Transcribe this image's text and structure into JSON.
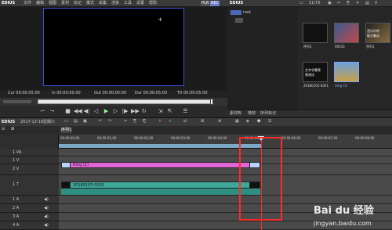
{
  "app": {
    "name": "EDIUS",
    "menus": [
      "文件",
      "编辑",
      "视图",
      "素材",
      "标记",
      "模式",
      "采集",
      "渲染",
      "工具",
      "设置",
      "帮助"
    ],
    "plr": "PLR",
    "rec": "REC"
  },
  "preview": {
    "cur": "Cur 00:00:05:00",
    "in": "In 00:00:00:00",
    "out": "Out 00:00:05:00",
    "dur": "Dur 00:00:05:00",
    "ttl": "Ttl 00:00:05:00",
    "tc_left": "00:00:05:00",
    "tc_right": "00:00:05:00"
  },
  "bin": {
    "app": "EDIUS",
    "path": "11/70",
    "folder_root": "root",
    "items": [
      {
        "label": "序列1"
      },
      {
        "label": "00033"
      },
      {
        "label": "序列1"
      },
      {
        "label": "20180105-0001"
      },
      {
        "label": "timg (1)"
      }
    ],
    "tabs": [
      "素材库",
      "特效",
      "序列标记"
    ],
    "thumb_text": [
      "音乐尔特",
      "能活着出",
      "文字字幕背",
      "景测试"
    ]
  },
  "timeline": {
    "app": "EDIUS",
    "project": "2017-12-19星期六",
    "tab": "序列1",
    "ruler_ticks": [
      "00:00:00;00",
      "00:00:01;00",
      "00:00:02;00",
      "00:00:03;00",
      "00:00:04;00",
      "00:00:05;00",
      "00:00:06;00",
      "00:00:07;00",
      "00:00:08;00"
    ],
    "tracks": [
      {
        "id": "1 VA",
        "type": "va"
      },
      {
        "id": "1 V",
        "type": "v"
      },
      {
        "id": "2 V",
        "type": "v"
      },
      {
        "id": "1 T",
        "type": "t"
      },
      {
        "id": "1 A",
        "type": "a"
      },
      {
        "id": "2 A",
        "type": "a"
      },
      {
        "id": "3 A",
        "type": "a"
      },
      {
        "id": "4 A",
        "type": "a"
      }
    ],
    "clip_image": "timg (1)",
    "clip_video": "20180105-0001"
  },
  "watermark": {
    "site": "jingyan.baidu.com",
    "brand": "Bai du 经验"
  },
  "colors": {
    "highlight": "#ff2b2b",
    "clip_image": "#e066d6",
    "clip_video": "#3ea99a"
  }
}
